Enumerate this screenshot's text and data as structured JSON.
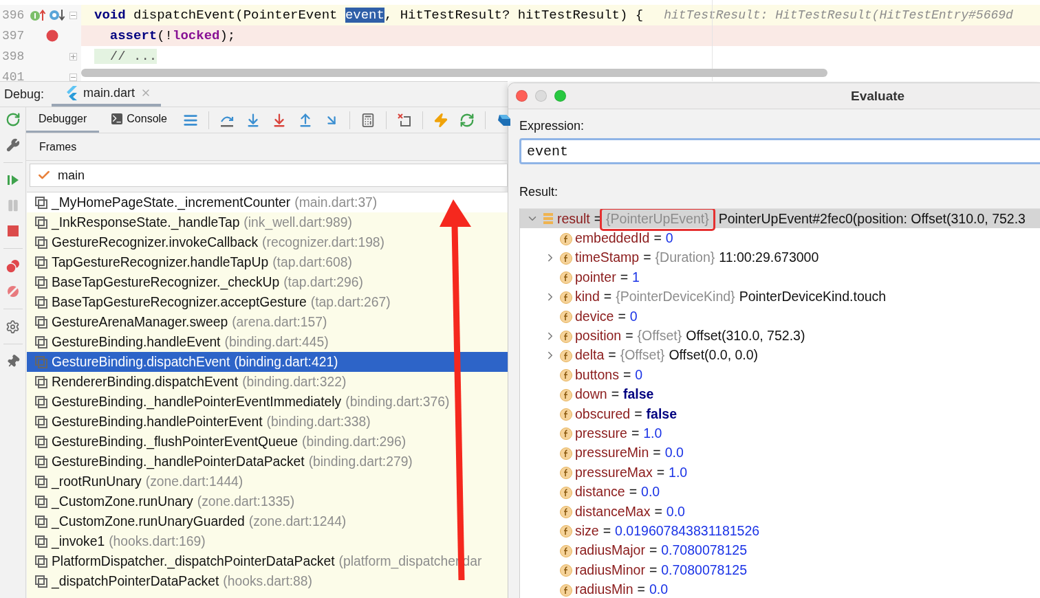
{
  "editor": {
    "lines": [
      {
        "number": "396",
        "kind": "current",
        "overrides": true,
        "breakpoint": false,
        "fold": {
          "expanded": true
        },
        "segments": [
          {
            "text": "void",
            "kind": "keyword"
          },
          {
            "text": " dispatchEvent(PointerEvent ",
            "kind": "plain"
          },
          {
            "text": "event",
            "kind": "selection"
          },
          {
            "text": ", HitTestResult? hitTestResult) {",
            "kind": "plain"
          }
        ],
        "hint": "hitTestResult: HitTestResult(HitTestEntry#5669d"
      },
      {
        "number": "397",
        "kind": "breakpoint",
        "overrides": false,
        "breakpoint": true,
        "segments": [
          {
            "text": "  assert",
            "kind": "keyword"
          },
          {
            "text": "(!",
            "kind": "plain"
          },
          {
            "text": "locked",
            "kind": "field"
          },
          {
            "text": ");",
            "kind": "plain"
          }
        ]
      },
      {
        "number": "398",
        "kind": "normal",
        "overrides": false,
        "breakpoint": false,
        "fold": {
          "expanded": false
        },
        "segments": [
          {
            "text": "  // ...",
            "kind": "folded"
          }
        ]
      },
      {
        "number": "401",
        "kind": "normal",
        "overrides": false,
        "breakpoint": false,
        "fold": {
          "expanded": true
        }
      }
    ]
  },
  "debug": {
    "label": "Debug:",
    "tabs": [
      {
        "label": "main.dart",
        "selected": true
      }
    ],
    "views": [
      {
        "label": "Debugger",
        "selected": true,
        "kind": "plain"
      },
      {
        "label": "Console",
        "selected": false,
        "kind": "console"
      }
    ],
    "frames_title": "Frames",
    "thread": {
      "value": "main"
    },
    "frames": [
      {
        "method": "_MyHomePageState._incrementCounter",
        "location": "(main.dart:37)",
        "library": false,
        "selected": false
      },
      {
        "method": "_InkResponseState._handleTap",
        "location": "(ink_well.dart:989)",
        "library": true,
        "selected": false
      },
      {
        "method": "GestureRecognizer.invokeCallback",
        "location": "(recognizer.dart:198)",
        "library": true,
        "selected": false
      },
      {
        "method": "TapGestureRecognizer.handleTapUp",
        "location": "(tap.dart:608)",
        "library": true,
        "selected": false
      },
      {
        "method": "BaseTapGestureRecognizer._checkUp",
        "location": "(tap.dart:296)",
        "library": true,
        "selected": false
      },
      {
        "method": "BaseTapGestureRecognizer.acceptGesture",
        "location": "(tap.dart:267)",
        "library": true,
        "selected": false
      },
      {
        "method": "GestureArenaManager.sweep",
        "location": "(arena.dart:157)",
        "library": true,
        "selected": false
      },
      {
        "method": "GestureBinding.handleEvent",
        "location": "(binding.dart:445)",
        "library": true,
        "selected": false
      },
      {
        "method": "GestureBinding.dispatchEvent",
        "location": "(binding.dart:421)",
        "library": true,
        "selected": true
      },
      {
        "method": "RendererBinding.dispatchEvent",
        "location": "(binding.dart:322)",
        "library": true,
        "selected": false
      },
      {
        "method": "GestureBinding._handlePointerEventImmediately",
        "location": "(binding.dart:376)",
        "library": true,
        "selected": false
      },
      {
        "method": "GestureBinding.handlePointerEvent",
        "location": "(binding.dart:338)",
        "library": true,
        "selected": false
      },
      {
        "method": "GestureBinding._flushPointerEventQueue",
        "location": "(binding.dart:296)",
        "library": true,
        "selected": false
      },
      {
        "method": "GestureBinding._handlePointerDataPacket",
        "location": "(binding.dart:279)",
        "library": true,
        "selected": false
      },
      {
        "method": "_rootRunUnary",
        "location": "(zone.dart:1444)",
        "library": true,
        "selected": false
      },
      {
        "method": "_CustomZone.runUnary",
        "location": "(zone.dart:1335)",
        "library": true,
        "selected": false
      },
      {
        "method": "_CustomZone.runUnaryGuarded",
        "location": "(zone.dart:1244)",
        "library": true,
        "selected": false
      },
      {
        "method": "_invoke1",
        "location": "(hooks.dart:169)",
        "library": true,
        "selected": false
      },
      {
        "method": "PlatformDispatcher._dispatchPointerDataPacket",
        "location": "(platform_dispatcher.dar",
        "library": true,
        "selected": false
      },
      {
        "method": "_dispatchPointerDataPacket",
        "location": "(hooks.dart:88)",
        "library": true,
        "selected": false
      }
    ]
  },
  "evaluate": {
    "title": "Evaluate",
    "expression_label": "Expression:",
    "expression": "event",
    "result_label": "Result:",
    "result": {
      "name": "result",
      "separator": "=",
      "type": "{PointerUpEvent}",
      "value": "PointerUpEvent#2fec0(position: Offset(310.0, 752.3",
      "expanded": true,
      "selected": true,
      "highlighted": true,
      "children": [
        {
          "name": "embeddedId",
          "separator": "=",
          "value": "0",
          "kind": "number",
          "expandable": false
        },
        {
          "name": "timeStamp",
          "separator": "=",
          "type": "{Duration}",
          "value": "11:00:29.673000",
          "kind": "object",
          "expandable": true
        },
        {
          "name": "pointer",
          "separator": "=",
          "value": "1",
          "kind": "number",
          "expandable": false
        },
        {
          "name": "kind",
          "separator": "=",
          "type": "{PointerDeviceKind}",
          "value": "PointerDeviceKind.touch",
          "kind": "object",
          "expandable": true
        },
        {
          "name": "device",
          "separator": "=",
          "value": "0",
          "kind": "number",
          "expandable": false
        },
        {
          "name": "position",
          "separator": "=",
          "type": "{Offset}",
          "value": "Offset(310.0, 752.3)",
          "kind": "object",
          "expandable": true
        },
        {
          "name": "delta",
          "separator": "=",
          "type": "{Offset}",
          "value": "Offset(0.0, 0.0)",
          "kind": "object",
          "expandable": true
        },
        {
          "name": "buttons",
          "separator": "=",
          "value": "0",
          "kind": "number",
          "expandable": false
        },
        {
          "name": "down",
          "separator": "=",
          "value": "false",
          "kind": "keyword",
          "expandable": false
        },
        {
          "name": "obscured",
          "separator": "=",
          "value": "false",
          "kind": "keyword",
          "expandable": false
        },
        {
          "name": "pressure",
          "separator": "=",
          "value": "1.0",
          "kind": "number",
          "expandable": false
        },
        {
          "name": "pressureMin",
          "separator": "=",
          "value": "0.0",
          "kind": "number",
          "expandable": false
        },
        {
          "name": "pressureMax",
          "separator": "=",
          "value": "1.0",
          "kind": "number",
          "expandable": false
        },
        {
          "name": "distance",
          "separator": "=",
          "value": "0.0",
          "kind": "number",
          "expandable": false
        },
        {
          "name": "distanceMax",
          "separator": "=",
          "value": "0.0",
          "kind": "number",
          "expandable": false
        },
        {
          "name": "size",
          "separator": "=",
          "value": "0.019607843831181526",
          "kind": "number",
          "expandable": false
        },
        {
          "name": "radiusMajor",
          "separator": "=",
          "value": "0.7080078125",
          "kind": "number",
          "expandable": false
        },
        {
          "name": "radiusMinor",
          "separator": "=",
          "value": "0.7080078125",
          "kind": "number",
          "expandable": false
        },
        {
          "name": "radiusMin",
          "separator": "=",
          "value": "0.0",
          "kind": "number",
          "expandable": false
        }
      ]
    }
  }
}
